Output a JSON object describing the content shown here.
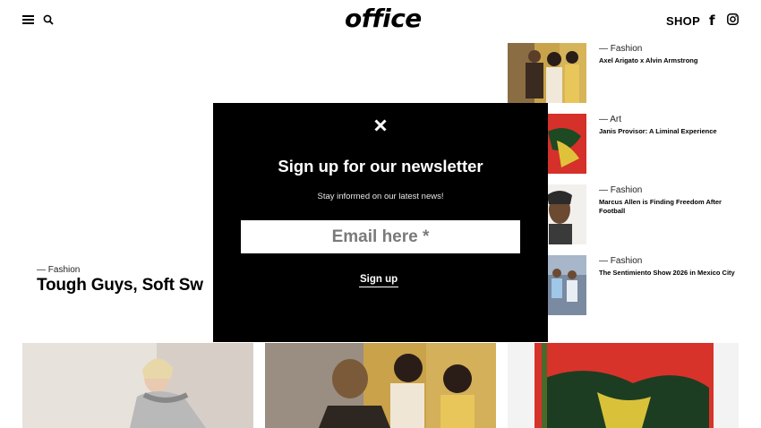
{
  "header": {
    "logo": "office",
    "shop_label": "SHOP",
    "icons": [
      "menu-icon",
      "search-icon",
      "facebook-icon",
      "instagram-icon"
    ]
  },
  "featured": {
    "category": "— Fashion",
    "title": "Tough Guys, Soft Sw"
  },
  "side_articles": [
    {
      "category": "— Fashion",
      "title": "Axel Arigato x Alvin Armstrong"
    },
    {
      "category": "— Art",
      "title": "Janis Provisor: A Liminal Experience"
    },
    {
      "category": "— Fashion",
      "title": "Marcus Allen is Finding Freedom After Football"
    },
    {
      "category": "— Fashion",
      "title": "The Sentimiento Show 2026 in Mexico City"
    }
  ],
  "modal": {
    "close_glyph": "✕",
    "title": "Sign up for our newsletter",
    "subtitle": "Stay informed on our latest news!",
    "email_placeholder": "Email here *",
    "submit_label": "Sign up"
  },
  "colors": {
    "modal_bg": "#000000",
    "modal_text": "#ffffff",
    "page_bg": "#ffffff"
  }
}
